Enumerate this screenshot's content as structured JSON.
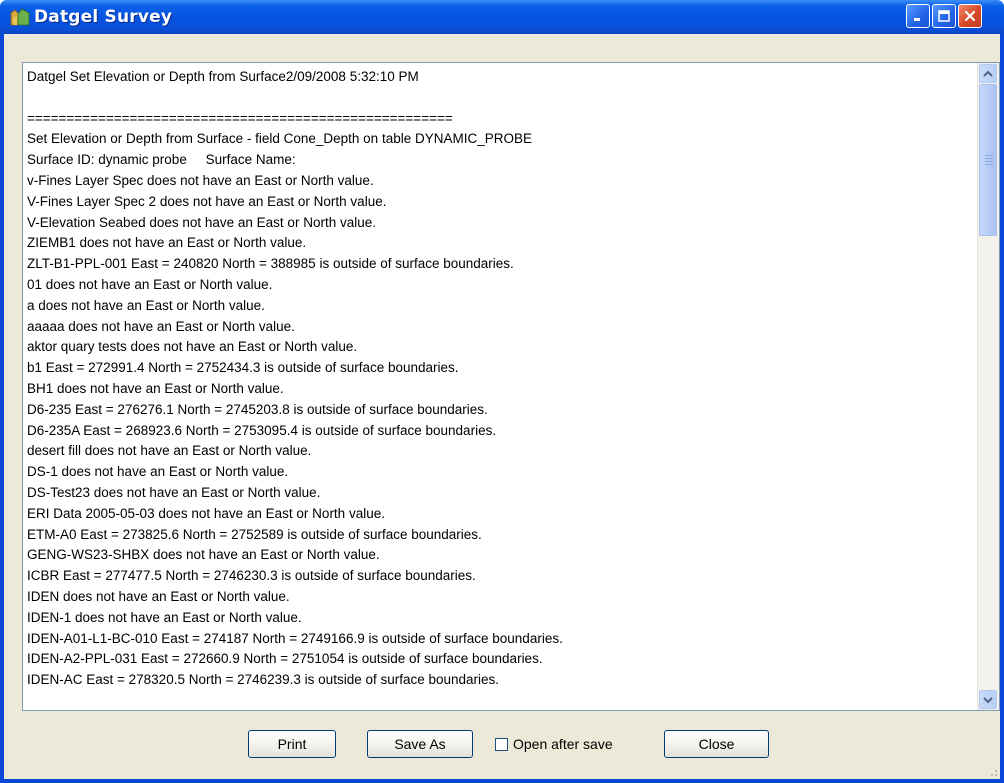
{
  "window": {
    "title": "Datgel Survey",
    "title_color": "#ffffff",
    "titlebar_color": "#0453e0",
    "close_color": "#d9482a"
  },
  "log": {
    "lines": [
      "Datgel Set Elevation or Depth from Surface2/09/2008 5:32:10 PM",
      "",
      "======================================================",
      "Set Elevation or Depth from Surface - field Cone_Depth on table DYNAMIC_PROBE",
      "Surface ID: dynamic probe     Surface Name:",
      "v-Fines Layer Spec does not have an East or North value.",
      "V-Fines Layer Spec 2 does not have an East or North value.",
      "V-Elevation Seabed does not have an East or North value.",
      "ZIEMB1 does not have an East or North value.",
      "ZLT-B1-PPL-001 East = 240820 North = 388985 is outside of surface boundaries.",
      "01 does not have an East or North value.",
      "a does not have an East or North value.",
      "aaaaa does not have an East or North value.",
      "aktor quary tests does not have an East or North value.",
      "b1 East = 272991.4 North = 2752434.3 is outside of surface boundaries.",
      "BH1 does not have an East or North value.",
      "D6-235 East = 276276.1 North = 2745203.8 is outside of surface boundaries.",
      "D6-235A East = 268923.6 North = 2753095.4 is outside of surface boundaries.",
      "desert fill does not have an East or North value.",
      "DS-1 does not have an East or North value.",
      "DS-Test23 does not have an East or North value.",
      "ERI Data 2005-05-03 does not have an East or North value.",
      "ETM-A0 East = 273825.6 North = 2752589 is outside of surface boundaries.",
      "GENG-WS23-SHBX does not have an East or North value.",
      "ICBR East = 277477.5 North = 2746230.3 is outside of surface boundaries.",
      "IDEN does not have an East or North value.",
      "IDEN-1 does not have an East or North value.",
      "IDEN-A01-L1-BC-010 East = 274187 North = 2749166.9 is outside of surface boundaries.",
      "IDEN-A2-PPL-031 East = 272660.9 North = 2751054 is outside of surface boundaries.",
      "IDEN-AC East = 278320.5 North = 2746239.3 is outside of surface boundaries."
    ]
  },
  "buttons": {
    "print": "Print",
    "save_as": "Save As",
    "open_after_save": "Open after save",
    "close": "Close"
  },
  "icons": {
    "app": "datgel-app-icon",
    "minimize": "minimize-icon",
    "maximize": "maximize-icon",
    "close": "close-icon",
    "scroll_up": "chevron-up-icon",
    "scroll_down": "chevron-down-icon"
  }
}
